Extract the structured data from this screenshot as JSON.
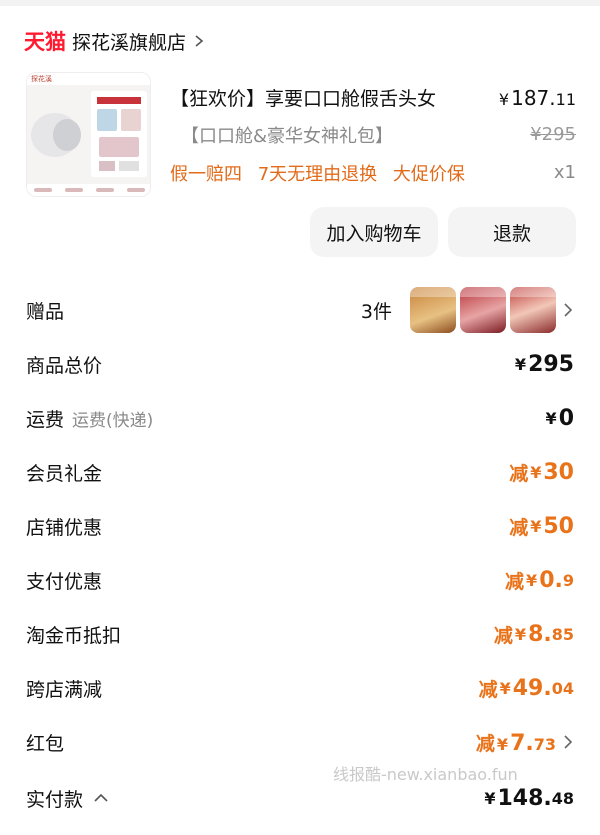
{
  "shop": {
    "brand_logo": "天猫",
    "name": "探花溪旗舰店"
  },
  "product": {
    "thumb_brand": "探花溪",
    "title": "【狂欢价】享要口口舱假舌头女",
    "variant": "【口口舱&豪华女神礼包】",
    "price_yen": "¥",
    "price_int": "187.",
    "price_dec": "11",
    "orig_price": "¥295",
    "guarantees": [
      "假一赔四",
      "7天无理由退换",
      "大促价保"
    ],
    "quantity": "x1"
  },
  "actions": {
    "add_to_cart": "加入购物车",
    "refund": "退款"
  },
  "summary": {
    "gift": {
      "label": "赠品",
      "count": "3件"
    },
    "total": {
      "label": "商品总价",
      "yen": "¥",
      "int": "295",
      "dec": ""
    },
    "shipping": {
      "label": "运费",
      "sublabel": "运费(快递)",
      "yen": "¥",
      "int": "0",
      "dec": ""
    },
    "member_gift": {
      "label": "会员礼金",
      "prefix": "减",
      "yen": "¥",
      "int": "30",
      "dec": ""
    },
    "shop_discount": {
      "label": "店铺优惠",
      "prefix": "减",
      "yen": "¥",
      "int": "50",
      "dec": ""
    },
    "pay_discount": {
      "label": "支付优惠",
      "prefix": "减",
      "yen": "¥",
      "int": "0.",
      "dec": "9"
    },
    "taojinbi": {
      "label": "淘金币抵扣",
      "prefix": "减",
      "yen": "¥",
      "int": "8.",
      "dec": "85"
    },
    "cross_store": {
      "label": "跨店满减",
      "prefix": "减",
      "yen": "¥",
      "int": "49.",
      "dec": "04"
    },
    "red_packet": {
      "label": "红包",
      "prefix": "减",
      "yen": "¥",
      "int": "7.",
      "dec": "73"
    },
    "paid": {
      "label": "实付款",
      "yen": "¥",
      "int": "148.",
      "dec": "48"
    }
  },
  "watermark": "线报酷-new.xianbao.fun",
  "colors": {
    "tmall_red": "#ff1a30",
    "discount_orange": "#e9731a",
    "guarantee_orange": "#e26b1a",
    "muted_gray": "#8a8a8a"
  }
}
